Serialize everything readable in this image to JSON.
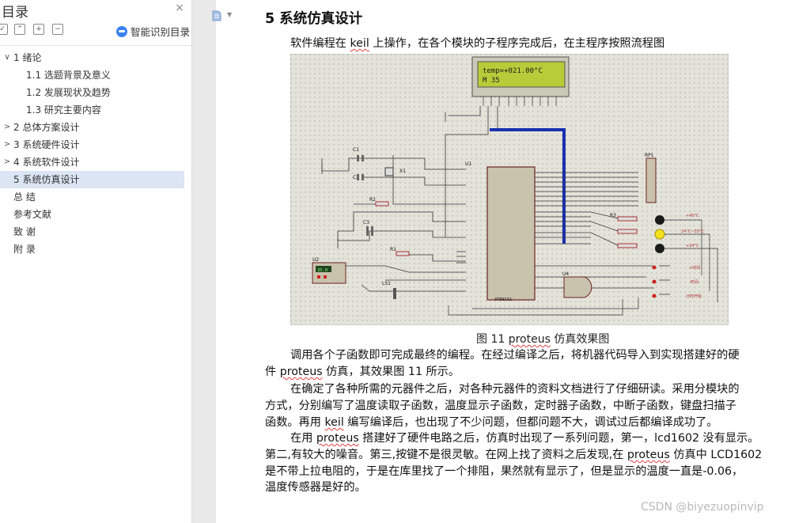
{
  "sidebar": {
    "title": "目录",
    "close_icon": "×",
    "smart_toc": "智能识别目录",
    "items": [
      {
        "label": "1  绪论",
        "level": 0,
        "chevron": "∨"
      },
      {
        "label": "1.1  选题背景及意义",
        "level": 1
      },
      {
        "label": "1.2  发展现状及趋势",
        "level": 1
      },
      {
        "label": "1.3  研究主要内容",
        "level": 1
      },
      {
        "label": "2  总体方案设计",
        "level": 0,
        "chevron": ">"
      },
      {
        "label": "3  系统硬件设计",
        "level": 0,
        "chevron": ">"
      },
      {
        "label": "4  系统软件设计",
        "level": 0,
        "chevron": ">"
      },
      {
        "label": "5  系统仿真设计",
        "level": 0,
        "active": true
      },
      {
        "label": "总    结",
        "level": 0
      },
      {
        "label": "参考文献",
        "level": 0
      },
      {
        "label": "致    谢",
        "level": 0
      },
      {
        "label": "附    录",
        "level": 0
      }
    ]
  },
  "document": {
    "heading": "5  系统仿真设计",
    "intro": [
      "软件编程在 ",
      "keil",
      " 上操作，在各个模块的子程序完成后，在主程序按照流程图"
    ],
    "lcd_line1": "temp=+021.00°C",
    "lcd_line2": "M 35",
    "caption": [
      "图 11 ",
      "proteus",
      " 仿真效果图"
    ],
    "p1_l1": "调用各个子函数即可完成最终的编程。在经过编译之后，将机器代码导入到实现搭建好的硬",
    "p1_l2": [
      "件 ",
      "proteus",
      " 仿真，其效果图 11 所示。"
    ],
    "p2_l1": "在确定了各种所需的元器件之后，对各种元器件的资料文档进行了仔细研读。采用分模块的",
    "p2_l2": "方式，分别编写了温度读取子函数，温度显示子函数，定时器子函数，中断子函数，键盘扫描子",
    "p2_l3": [
      "函数。再用 ",
      "keil",
      " 编写编译后，也出现了不少问题，但都问题不大，调试过后都编译成功了。"
    ],
    "p3_l1": [
      "在用 ",
      "proteus",
      " 搭建好了硬件电路之后，仿真时出现了一系列问题，第一，lcd1602 没有显示。"
    ],
    "p3_l2": [
      "第二,有较大的噪音。第三,按键不是很灵敏。在网上找了资料之后发现,在 ",
      "proteus",
      " 仿真中 LCD1602"
    ],
    "p3_l3": "是不带上拉电阻的，于是在库里找了一个排阻，果然就有显示了，但是显示的温度一直是-0.06，",
    "p3_l4": "温度传感器是好的。"
  },
  "schematic_labels": {
    "u1": "U1",
    "u2": "U2",
    "u4": "U4",
    "rp1": "RP1",
    "x1": "X1",
    "c1": "C1",
    "c2": "C2",
    "c3": "C3",
    "r1": "R1",
    "r2": "R2",
    "r3": "R3",
    "ls1": "LS1",
    "chip": "AT89C51",
    "u2_value": "35.0"
  },
  "watermark": "CSDN @biyezuopinvip"
}
